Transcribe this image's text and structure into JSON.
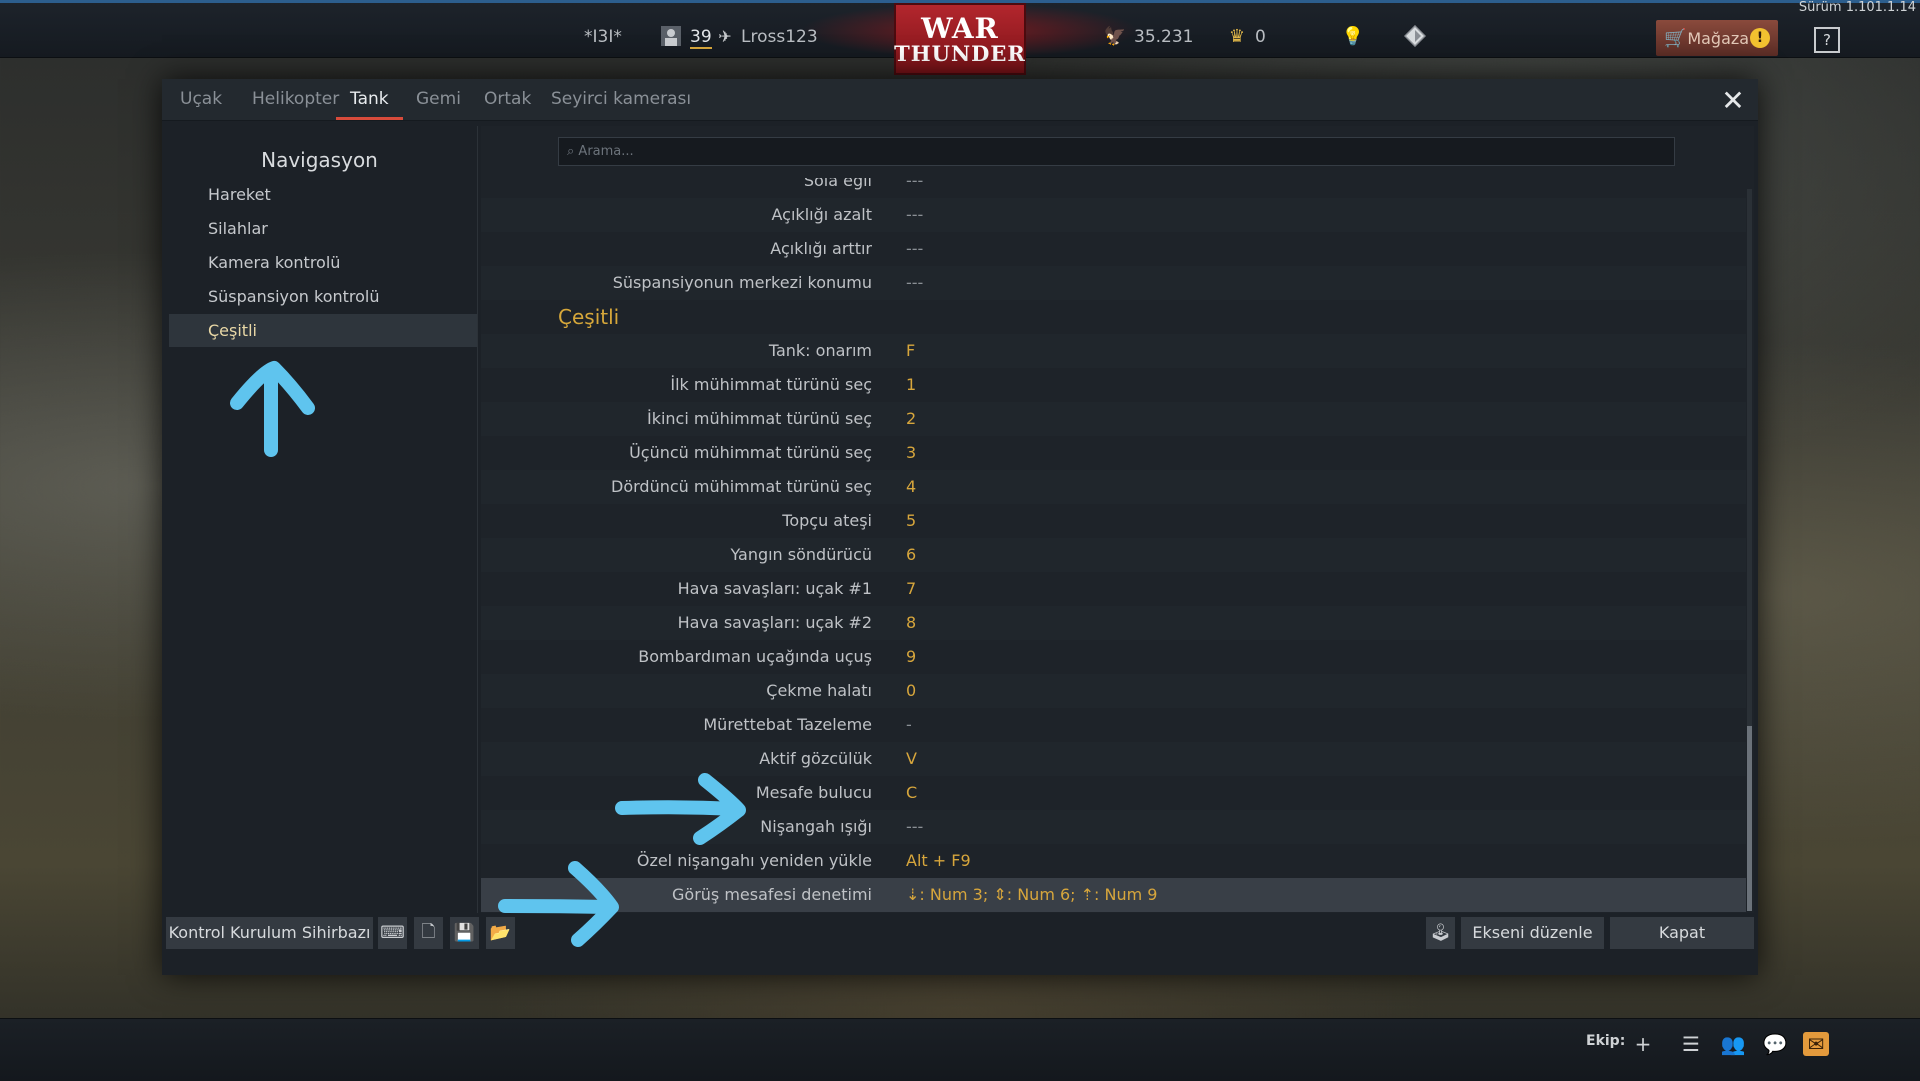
{
  "topbar": {
    "version": "Sürüm 1.101.1.14",
    "squad_tag": "*I3I*",
    "level": "39",
    "username": "Lross123",
    "logo_line1": "WAR",
    "logo_line2": "THUNDER",
    "silver_lions": "35.231",
    "golden_eagles": "0",
    "store_label": "Mağaza",
    "help_label": "?"
  },
  "tabs": [
    {
      "label": "Uçak"
    },
    {
      "label": "Helikopter"
    },
    {
      "label": "Tank"
    },
    {
      "label": "Gemi"
    },
    {
      "label": "Ortak"
    },
    {
      "label": "Seyirci kamerası"
    }
  ],
  "active_tab": "Tank",
  "nav": {
    "title": "Navigasyon",
    "items": [
      {
        "label": "Hareket"
      },
      {
        "label": "Silahlar"
      },
      {
        "label": "Kamera kontrolü"
      },
      {
        "label": "Süspansiyon kontrolü"
      },
      {
        "label": "Çeşitli"
      }
    ],
    "active": "Çeşitli"
  },
  "search": {
    "placeholder": "Arama..."
  },
  "rows": [
    {
      "label": "Sola eğil",
      "key": "---"
    },
    {
      "label": "Açıklığı azalt",
      "key": "---"
    },
    {
      "label": "Açıklığı arttır",
      "key": "---"
    },
    {
      "label": "Süspansiyonun merkezi konumu",
      "key": "---"
    },
    {
      "section": "Çeşitli"
    },
    {
      "label": "Tank: onarım",
      "key": "F"
    },
    {
      "label": "İlk mühimmat türünü seç",
      "key": "1"
    },
    {
      "label": "İkinci mühimmat türünü seç",
      "key": "2"
    },
    {
      "label": "Üçüncü mühimmat türünü seç",
      "key": "3"
    },
    {
      "label": "Dördüncü mühimmat türünü seç",
      "key": "4"
    },
    {
      "label": "Topçu ateşi",
      "key": "5"
    },
    {
      "label": "Yangın söndürücü",
      "key": "6"
    },
    {
      "label": "Hava savaşları: uçak #1",
      "key": "7"
    },
    {
      "label": "Hava savaşları: uçak #2",
      "key": "8"
    },
    {
      "label": "Bombardıman uçağında uçuş",
      "key": "9"
    },
    {
      "label": "Çekme halatı",
      "key": "0"
    },
    {
      "label": "Mürettebat Tazeleme",
      "key": "-"
    },
    {
      "label": "Aktif gözcülük",
      "key": "V"
    },
    {
      "label": "Mesafe bulucu",
      "key": "C"
    },
    {
      "label": "Nişangah ışığı",
      "key": "---"
    },
    {
      "label": "Özel nişangahı yeniden yükle",
      "key": "Alt + F9"
    },
    {
      "label": "Görüş mesafesi denetimi",
      "key": "⇣: Num 3;  ⇕: Num 6;  ⇡: Num 9"
    }
  ],
  "bottom": {
    "wizard_label": "Kontrol Kurulum Sihirbazı",
    "axis_label": "Ekseni düzenle",
    "close_label": "Kapat"
  },
  "footer": {
    "squad_label": "Ekip:"
  },
  "colors": {
    "accent": "#d84b3b",
    "key": "#d7a63c",
    "annotation": "#5fc4ee"
  }
}
